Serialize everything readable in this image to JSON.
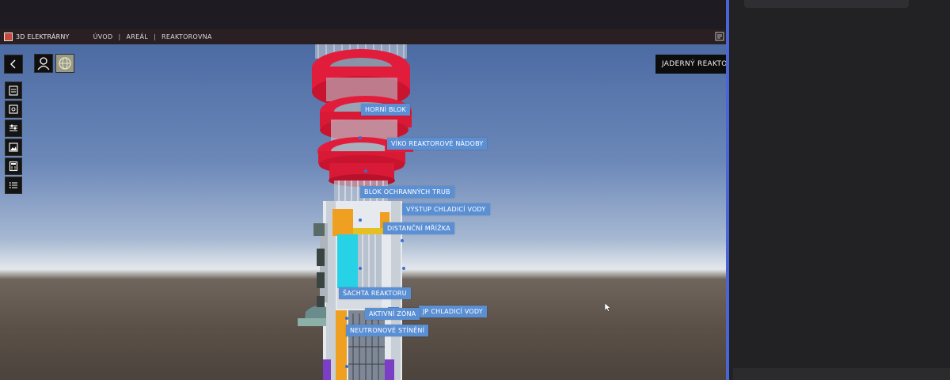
{
  "app": {
    "title": "3D ELEKTRÁRNY",
    "breadcrumb": [
      "ÚVOD",
      "AREÁL",
      "REAKTOROVNA"
    ],
    "breadcrumb_separator": "|"
  },
  "header_label": "JADERNÝ REAKTOR",
  "toolbar": {
    "icons": [
      "back-arrow-icon",
      "person-icon",
      "globe-icon",
      "clipboard-icon",
      "map-icon",
      "sliders-icon",
      "image-icon",
      "calculator-icon",
      "list-icon"
    ]
  },
  "labels": {
    "horni_blok": "HORNÍ BLOK",
    "viko": "VÍKO REAKTOROVÉ NÁDOBY",
    "blok_trub": "BLOK OCHRANNÝCH TRUB",
    "vystup": "VÝSTUP CHLADICÍ VODY",
    "mrizka": "DISTANČNÍ MŘÍŽKA",
    "sachta": "ŠACHTA REAKTORU",
    "vstup": "JP CHLADICÍ VODY",
    "aktivni": "AKTIVNÍ ZÓNA",
    "stineni": "NEUTRONOVÉ STÍNĚNÍ"
  },
  "colors": {
    "label_bg": "#5a8fd4",
    "accent_red": "#e0203a",
    "divider_blue": "#4a66d6"
  }
}
